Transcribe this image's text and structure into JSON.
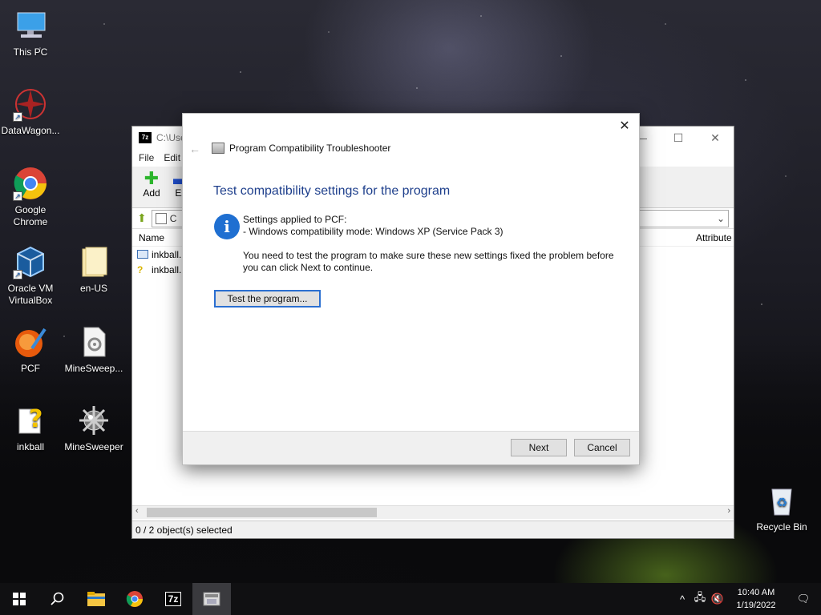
{
  "desktop": {
    "icons": [
      {
        "label": "This PC",
        "icon": "computer-icon"
      },
      {
        "label": "DataWagon...",
        "icon": "datawagon-icon"
      },
      {
        "label": "Google Chrome",
        "icon": "chrome-icon"
      },
      {
        "label": "Oracle VM VirtualBox",
        "icon": "virtualbox-icon"
      },
      {
        "label": "en-US",
        "icon": "folder-icon"
      },
      {
        "label": "PCF",
        "icon": "pcf-icon"
      },
      {
        "label": "MineSweep...",
        "icon": "file-gear-icon"
      },
      {
        "label": "inkball",
        "icon": "inkball-icon"
      },
      {
        "label": "MineSweeper",
        "icon": "minesweeper-icon"
      },
      {
        "label": "Recycle Bin",
        "icon": "recycle-bin-icon"
      }
    ]
  },
  "zip_window": {
    "title": "C:\\Use",
    "menu": [
      "File",
      "Edit"
    ],
    "toolbar": [
      {
        "label": "Add",
        "icon": "plus-icon"
      },
      {
        "label": "Ext",
        "icon": "minus-icon"
      }
    ],
    "address": "C",
    "columns": {
      "name": "Name",
      "attributes": "Attribute"
    },
    "rows": [
      "inkball.",
      "inkball."
    ],
    "status": "0 / 2 object(s) selected"
  },
  "dialog": {
    "title": "Program Compatibility Troubleshooter",
    "heading": "Test compatibility settings for the program",
    "settings_line1": "Settings applied to PCF:",
    "settings_line2": "- Windows compatibility mode: Windows XP (Service Pack 3)",
    "message": "You need to test the program to make sure these new settings fixed the problem before you can click Next to continue.",
    "test_button": "Test the program...",
    "next_button": "Next",
    "cancel_button": "Cancel"
  },
  "taskbar": {
    "time": "10:40 AM",
    "date": "1/19/2022"
  },
  "colors": {
    "accent": "#2b6fd1",
    "heading": "#1e3f8c",
    "taskbar": "#101012"
  }
}
